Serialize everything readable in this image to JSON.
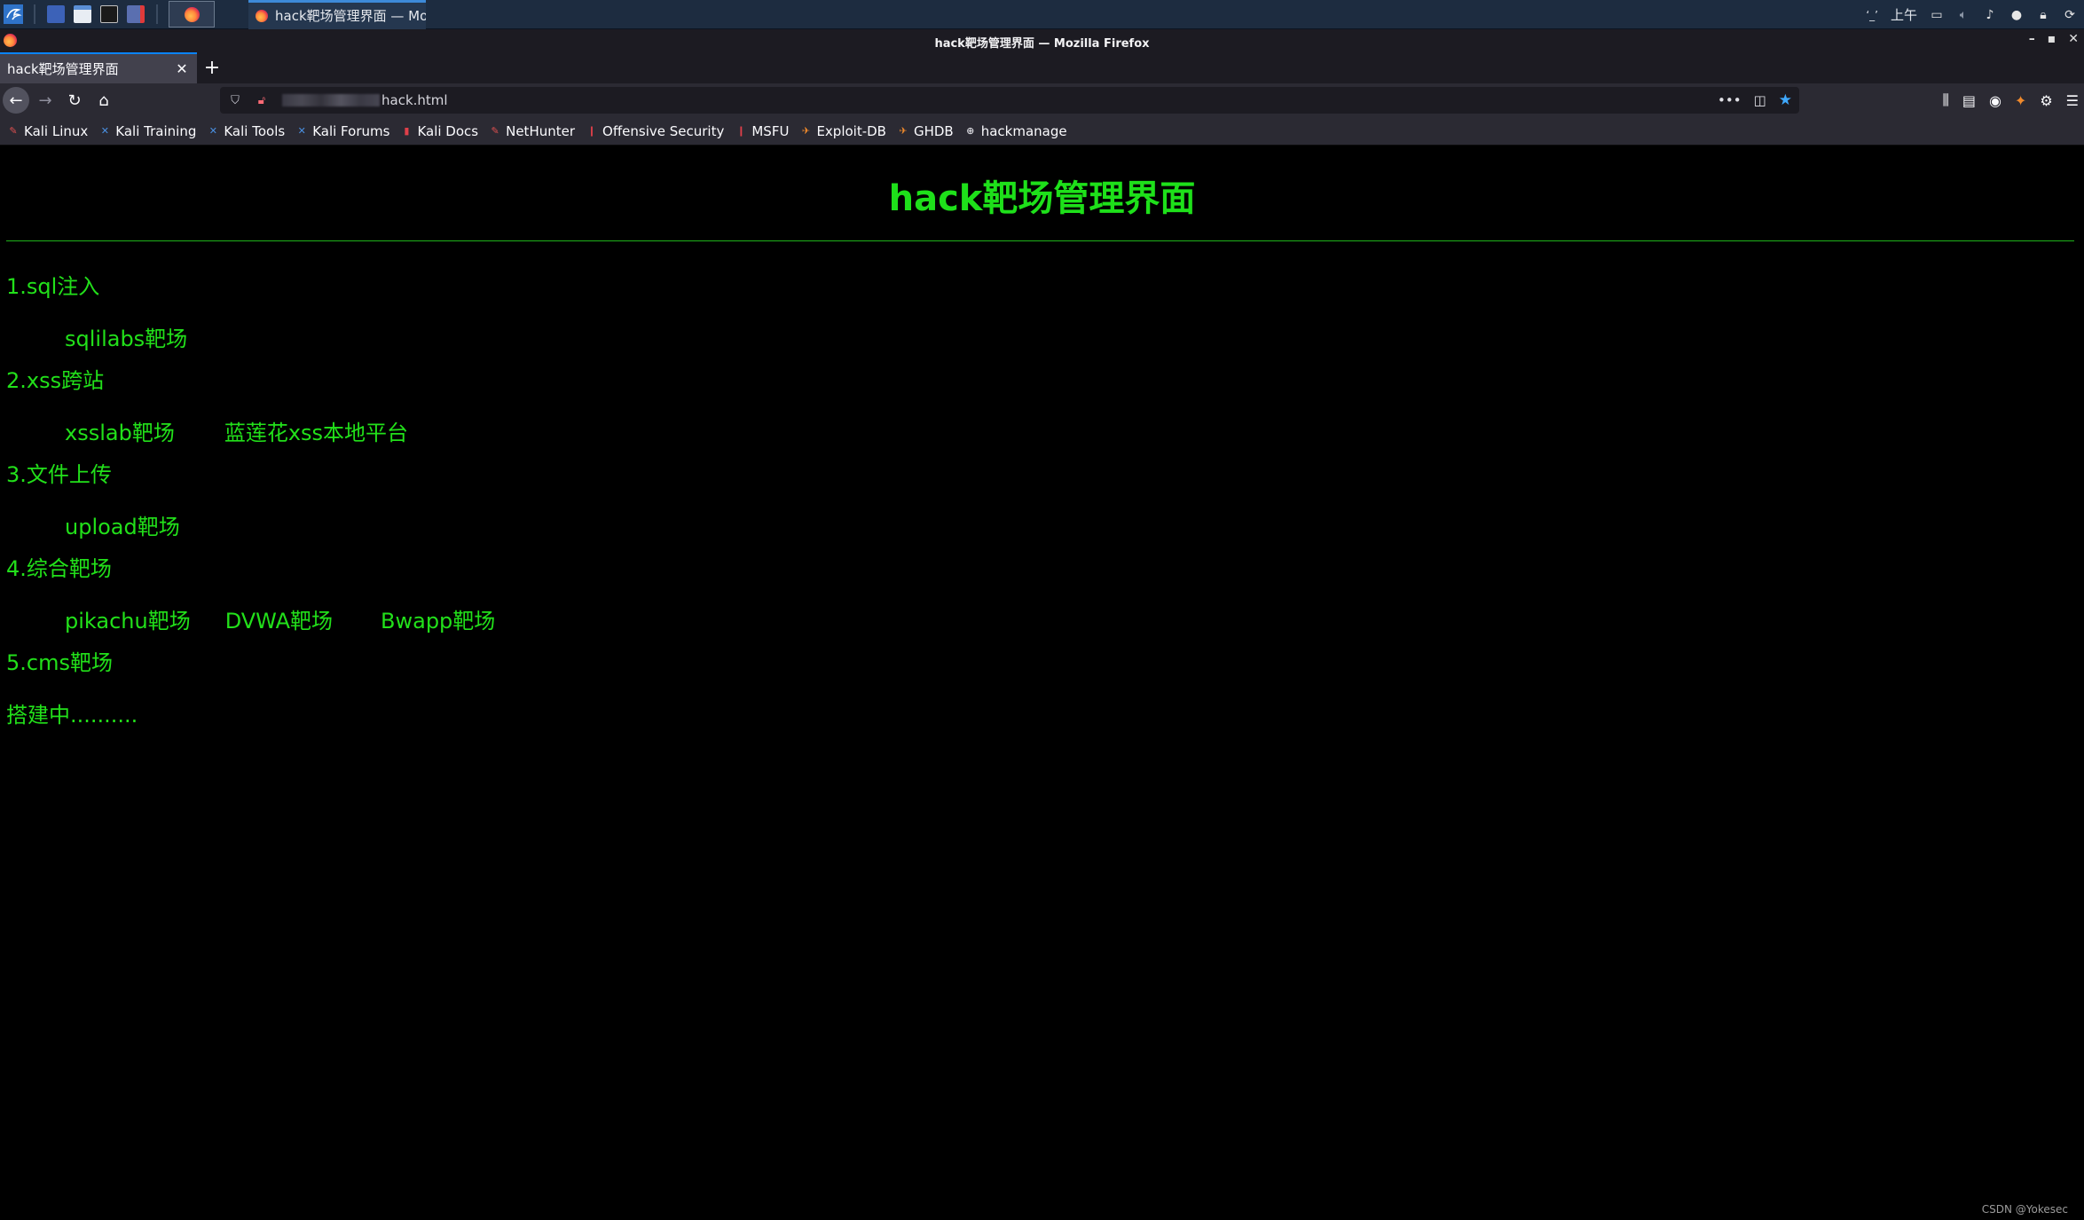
{
  "taskbar": {
    "task_title": "hack靶场管理界面 — Mo",
    "clock": "上午",
    "tray_text": "‘_’"
  },
  "window": {
    "title": "hack靶场管理界面 — Mozilla Firefox"
  },
  "tabs": [
    {
      "label": "hack靶场管理界面",
      "active": true
    }
  ],
  "urlbar": {
    "url_suffix": "hack.html",
    "more_label": "•••"
  },
  "bookmarks": [
    {
      "label": "Kali Linux",
      "icon": "kali-icon"
    },
    {
      "label": "Kali Training",
      "icon": "kali-tool-icon"
    },
    {
      "label": "Kali Tools",
      "icon": "kali-tool-icon"
    },
    {
      "label": "Kali Forums",
      "icon": "kali-tool-icon"
    },
    {
      "label": "Kali Docs",
      "icon": "kali-docs-icon"
    },
    {
      "label": "NetHunter",
      "icon": "kali-icon"
    },
    {
      "label": "Offensive Security",
      "icon": "offsec-icon"
    },
    {
      "label": "MSFU",
      "icon": "offsec-icon"
    },
    {
      "label": "Exploit-DB",
      "icon": "exploit-db-icon"
    },
    {
      "label": "GHDB",
      "icon": "exploit-db-icon"
    },
    {
      "label": "hackmanage",
      "icon": "globe-icon"
    }
  ],
  "page": {
    "title": "hack靶场管理界面",
    "sections": [
      {
        "heading": "1.sql注入",
        "links": [
          "sqlilabs靶场"
        ]
      },
      {
        "heading": "2.xss跨站",
        "links": [
          "xsslab靶场",
          "蓝莲花xss本地平台"
        ]
      },
      {
        "heading": "3.文件上传",
        "links": [
          "upload靶场"
        ]
      },
      {
        "heading": "4.综合靶场",
        "links": [
          "pikachu靶场",
          "DVWA靶场",
          "Bwapp靶场"
        ]
      },
      {
        "heading": "5.cms靶场",
        "links": []
      }
    ],
    "footer_text": "搭建中.........."
  },
  "watermark": "CSDN @Yokesec",
  "colors": {
    "page_bg": "#000000",
    "page_text": "#22e01a",
    "browser_chrome": "#2b2a33",
    "tab_accent": "#0a84ff"
  }
}
